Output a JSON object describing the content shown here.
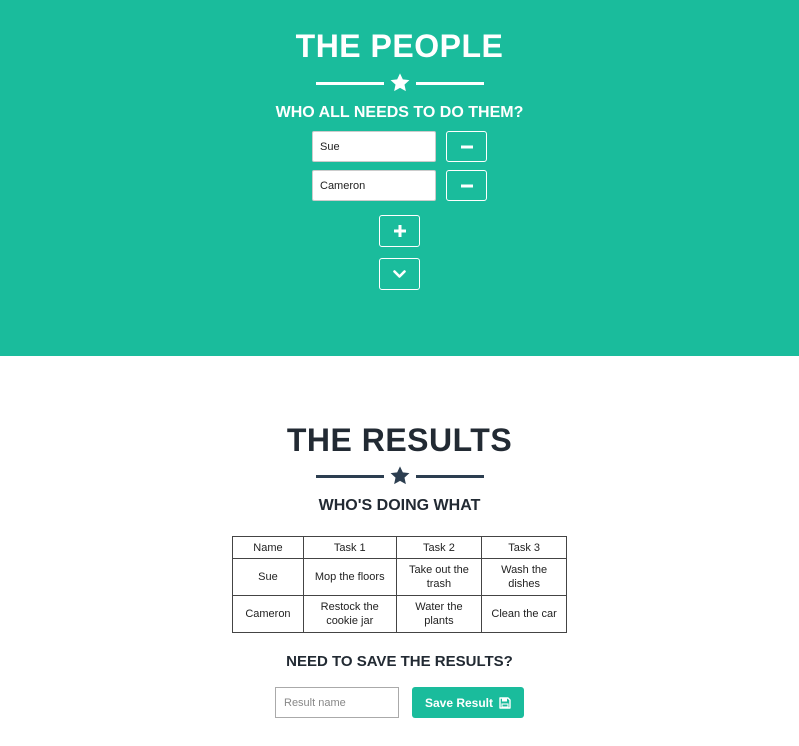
{
  "people": {
    "title": "THE PEOPLE",
    "subtitle": "WHO ALL NEEDS TO DO THEM?",
    "entries": [
      {
        "name": "Sue"
      },
      {
        "name": "Cameron"
      }
    ],
    "icons": {
      "star": "star-icon",
      "remove": "minus-icon",
      "add": "plus-icon",
      "next": "chevron-down-icon"
    }
  },
  "results": {
    "title": "THE RESULTS",
    "subtitle": "WHO'S DOING WHAT",
    "table": {
      "headers": [
        "Name",
        "Task 1",
        "Task 2",
        "Task 3"
      ],
      "rows": [
        [
          "Sue",
          "Mop the floors",
          "Take out the trash",
          "Wash the dishes"
        ],
        [
          "Cameron",
          "Restock the cookie jar",
          "Water the plants",
          "Clean the car"
        ]
      ]
    },
    "save": {
      "heading": "NEED TO SAVE THE RESULTS?",
      "placeholder": "Result name",
      "button_label": "Save Result",
      "icon": "save-icon"
    }
  },
  "colors": {
    "accent": "#1abc9c",
    "dark": "#2c3e50"
  }
}
